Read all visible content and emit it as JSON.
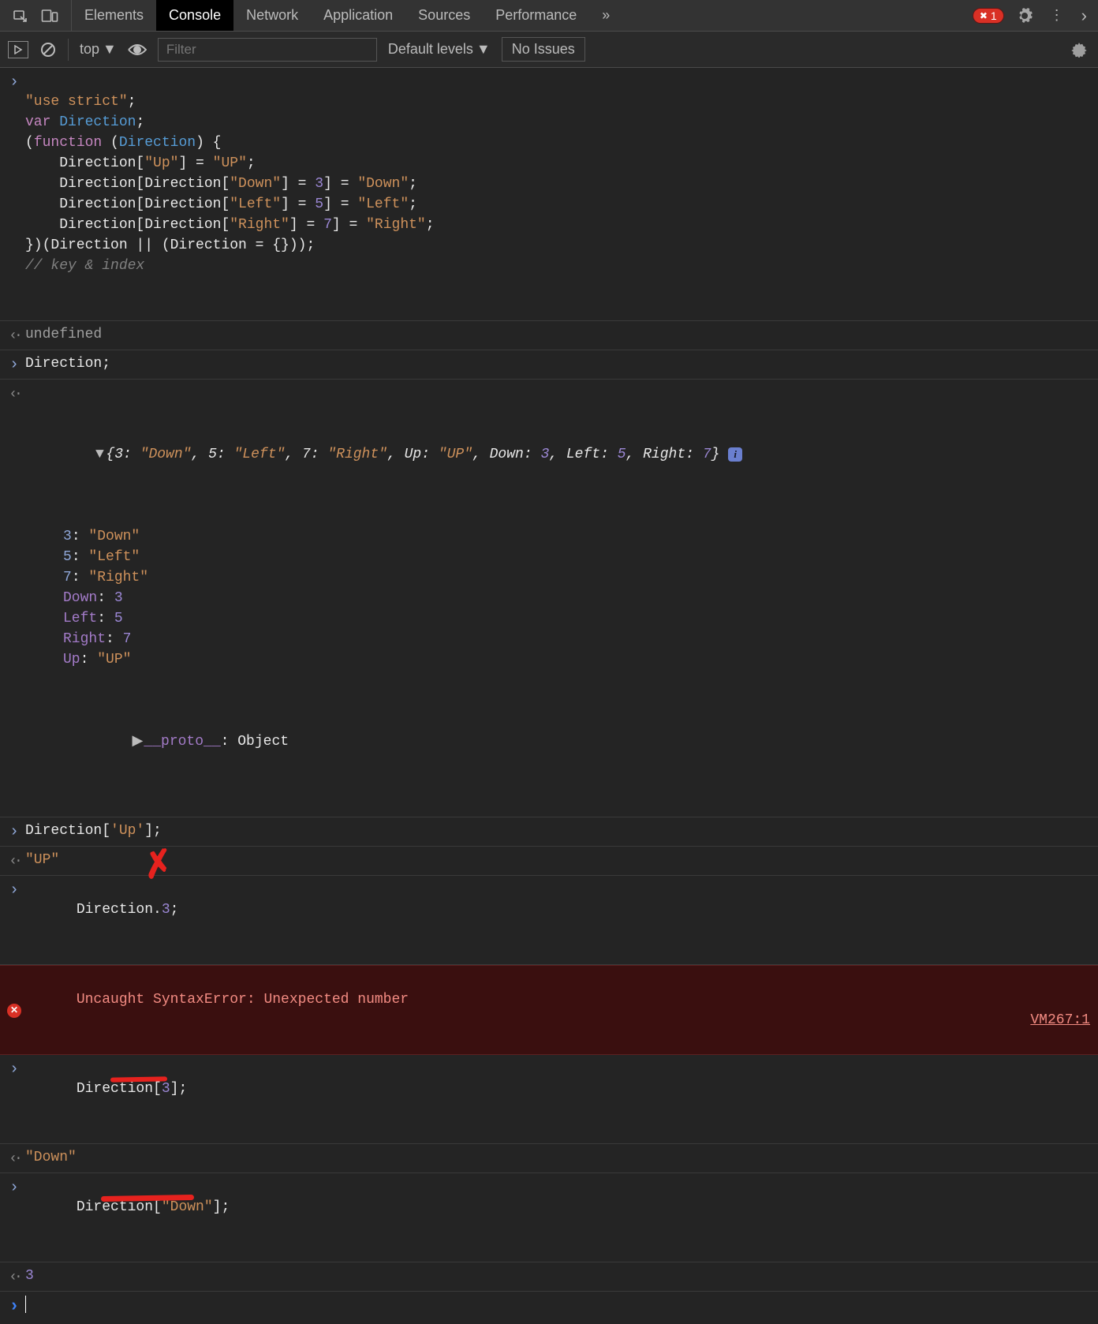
{
  "tabs": {
    "items": [
      "Elements",
      "Console",
      "Network",
      "Application",
      "Sources",
      "Performance"
    ],
    "active_index": 1,
    "error_count": "1"
  },
  "toolbar": {
    "context": "top",
    "filter_placeholder": "Filter",
    "levels": "Default levels",
    "issues": "No Issues"
  },
  "code_block1": {
    "l1_str": "\"use strict\"",
    "l2_kw": "var",
    "l2_name": "Direction",
    "l3_open": "(",
    "l3_kw": "function",
    "l3_paren_open": " (",
    "l3_param": "Direction",
    "l3_paren_close": ") {",
    "l4a": "    Direction[",
    "l4b": "\"Up\"",
    "l4c": "] = ",
    "l4d": "\"UP\"",
    "l4e": ";",
    "l5a": "    Direction[Direction[",
    "l5b": "\"Down\"",
    "l5c": "] = ",
    "l5d": "3",
    "l5e": "] = ",
    "l5f": "\"Down\"",
    "l5g": ";",
    "l6a": "    Direction[Direction[",
    "l6b": "\"Left\"",
    "l6c": "] = ",
    "l6d": "5",
    "l6e": "] = ",
    "l6f": "\"Left\"",
    "l6g": ";",
    "l7a": "    Direction[Direction[",
    "l7b": "\"Right\"",
    "l7c": "] = ",
    "l7d": "7",
    "l7e": "] = ",
    "l7f": "\"Right\"",
    "l7g": ";",
    "l8": "})(Direction || (Direction = {}));",
    "l9_comment": "// key & index"
  },
  "output1": "undefined",
  "input2": "Direction;",
  "obj_preview": {
    "open": "{",
    "k1": "3",
    "v1": "\"Down\"",
    "k2": "5",
    "v2": "\"Left\"",
    "k3": "7",
    "v3": "\"Right\"",
    "k4": "Up",
    "v4": "\"UP\"",
    "k5": "Down",
    "v5": "3",
    "k6": "Left",
    "v6": "5",
    "k7": "Right",
    "v7": "7",
    "close": "}",
    "info": "i"
  },
  "obj_expanded": [
    {
      "k": "3",
      "v": "\"Down\"",
      "kcolor": "propkey",
      "vcolor": "str"
    },
    {
      "k": "5",
      "v": "\"Left\"",
      "kcolor": "propkey",
      "vcolor": "str"
    },
    {
      "k": "7",
      "v": "\"Right\"",
      "kcolor": "propkey",
      "vcolor": "str"
    },
    {
      "k": "Down",
      "v": "3",
      "kcolor": "proto",
      "vcolor": "num"
    },
    {
      "k": "Left",
      "v": "5",
      "kcolor": "proto",
      "vcolor": "num"
    },
    {
      "k": "Right",
      "v": "7",
      "kcolor": "proto",
      "vcolor": "num"
    },
    {
      "k": "Up",
      "v": "\"UP\"",
      "kcolor": "proto",
      "vcolor": "str"
    }
  ],
  "proto_key": "__proto__",
  "proto_val": "Object",
  "input3a": "Direction[",
  "input3b": "'Up'",
  "input3c": "];",
  "output3": "\"UP\"",
  "input4a": "Direction.",
  "input4b": "3",
  "input4c": ";",
  "error_msg": "Uncaught SyntaxError: Unexpected number",
  "error_src": "VM267:1",
  "input5a": "Direction[",
  "input5b": "3",
  "input5c": "];",
  "output5": "\"Down\"",
  "input6a": "Direction[",
  "input6b": "\"Down\"",
  "input6c": "];",
  "output6": "3"
}
